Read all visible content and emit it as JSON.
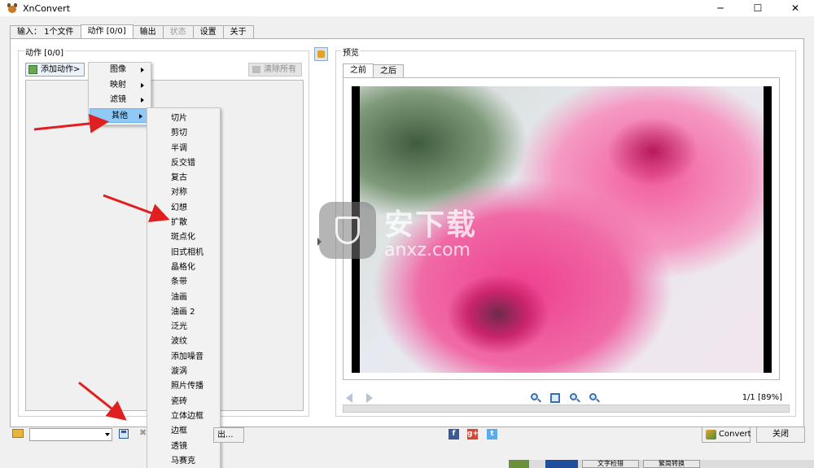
{
  "window": {
    "title": "XnConvert",
    "minimize": "─",
    "maximize": "☐",
    "close": "✕"
  },
  "tabs": [
    {
      "label": "输入： 1个文件"
    },
    {
      "label": "动作 [0/0]"
    },
    {
      "label": "输出"
    },
    {
      "label": "状态"
    },
    {
      "label": "设置"
    },
    {
      "label": "关于"
    }
  ],
  "actions_panel": {
    "group_label": "动作 [0/0]",
    "add_action": "添加动作>",
    "clear_all": "清除所有"
  },
  "context_menu": {
    "items": [
      "图像",
      "映射",
      "滤镜",
      "其他"
    ],
    "highlighted": "其他"
  },
  "submenu": {
    "items": [
      "切片",
      "剪切",
      "半调",
      "反交错",
      "复古",
      "对称",
      "幻想",
      "扩散",
      "斑点化",
      "旧式相机",
      "晶格化",
      "条带",
      "油画",
      "油画 2",
      "泛光",
      "波纹",
      "添加噪音",
      "漩涡",
      "照片传播",
      "瓷砖",
      "立体边框",
      "边框",
      "透镜",
      "马赛克"
    ]
  },
  "preview": {
    "group_label": "预览",
    "tab_before": "之前",
    "tab_after": "之后",
    "page_info": "1/1 [89%]",
    "watermark_cn": "安下载",
    "watermark_en": "anxz.com"
  },
  "bottom": {
    "load_button": "出...",
    "convert_button": "Convert",
    "close_button": "关闭",
    "facebook": "f",
    "google": "g+",
    "twitter": "t"
  },
  "background_window": {
    "btn1": "文字检错",
    "btn2": "繁简转换"
  },
  "colors": {
    "menu_highlight": "#90c8f6",
    "arrow_red": "#e02020",
    "accent_blue": "#3a6fb0"
  }
}
